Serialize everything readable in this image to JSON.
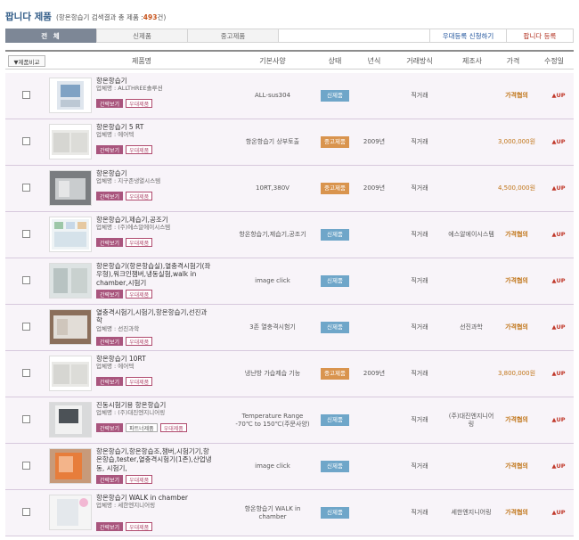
{
  "header": {
    "title": "팝니다 제품",
    "sub": "(항온항습기 검색결과 총 제품 :",
    "count": "493",
    "sub2": "건)"
  },
  "tabs": [
    {
      "label": "전 체",
      "kind": "active"
    },
    {
      "label": "신제품",
      "kind": "normal"
    },
    {
      "label": "중고제품",
      "kind": "normal"
    },
    {
      "label": "",
      "kind": "blank"
    },
    {
      "label": "우대등록 신청하기",
      "kind": "link"
    },
    {
      "label": "팝니다 등록",
      "kind": "link red"
    }
  ],
  "table_header": {
    "compare": "▼제품비교",
    "name": "제품명",
    "spec": "기본사양",
    "status": "상태",
    "year": "년식",
    "trade": "거래방식",
    "maker": "제조사",
    "price": "가격",
    "updated": "수정일"
  },
  "labels": {
    "detail": "간략보기",
    "preferred": "우대제품",
    "partner": "파트너제품",
    "up": "▲UP"
  },
  "colors": {
    "accent": "#2f5a86",
    "new_badge": "#6fa6c9",
    "used_badge": "#d9944e",
    "price": "#c07417"
  },
  "rows": [
    {
      "name": "항온항습기",
      "company": "업체명 : ALLTHREE솔루션",
      "spec": "ALL-sus304",
      "status": "신제품",
      "status_kind": "new",
      "year": "",
      "trade": "직거래",
      "maker": "",
      "price": "가격협의",
      "price_kind": "nego",
      "partner": false,
      "thumb": "blue"
    },
    {
      "name": "항온항습기 5 RT",
      "company": "업체명 : 에어텍",
      "spec": "항온항습기 상부토출",
      "status": "중고제품",
      "status_kind": "used",
      "year": "2009년",
      "trade": "직거래",
      "maker": "",
      "price": "3,000,000원",
      "price_kind": "num",
      "partner": false,
      "thumb": "cabinet"
    },
    {
      "name": "항온항습기",
      "company": "업체명 : 지구존냉열시스템",
      "spec": "10RT,380V",
      "status": "중고제품",
      "status_kind": "used",
      "year": "2009년",
      "trade": "직거래",
      "maker": "",
      "price": "4,500,000원",
      "price_kind": "num",
      "partner": false,
      "thumb": "dark"
    },
    {
      "name": "항온항습기,제습기,공조기",
      "company": "업체명 : (주)에스알에이시스템",
      "spec": "항온항습기,제습기,공조기",
      "status": "신제품",
      "status_kind": "new",
      "year": "",
      "trade": "직거래",
      "maker": "에스알에이시스템",
      "price": "가격협의",
      "price_kind": "nego",
      "partner": false,
      "thumb": "chart"
    },
    {
      "name": "항온항습기(항온항습실),열충격시험기(좌우형),워크인챔버,냉동실험,walk in chamber,시험기",
      "company": "",
      "spec": "image click",
      "status": "신제품",
      "status_kind": "new",
      "year": "",
      "trade": "직거래",
      "maker": "",
      "price": "가격협의",
      "price_kind": "nego",
      "partner": false,
      "thumb": "room"
    },
    {
      "name": "열충격시험기,시험기,항온항습기,선진과학",
      "company": "업체명 : 선진과학",
      "spec": "3존 열충격시험기",
      "status": "신제품",
      "status_kind": "new",
      "year": "",
      "trade": "직거래",
      "maker": "선진과학",
      "price": "가격협의",
      "price_kind": "nego",
      "partner": false,
      "thumb": "room2"
    },
    {
      "name": "항온항습기 10RT",
      "company": "업체명 : 에어텍",
      "spec": "냉난방 가습제습 기능",
      "status": "중고제품",
      "status_kind": "used",
      "year": "2009년",
      "trade": "직거래",
      "maker": "",
      "price": "3,800,000원",
      "price_kind": "num",
      "partner": false,
      "thumb": "cabinet"
    },
    {
      "name": "진동시험기용 항온항습기",
      "company": "업체명 : (주)대진엔지니어링",
      "spec": "Temperature Range -70℃ to 150℃(주문사양)",
      "status": "신제품",
      "status_kind": "new",
      "year": "",
      "trade": "직거래",
      "maker": "(주)대진엔지니어링",
      "price": "가격협의",
      "price_kind": "nego",
      "partner": true,
      "thumb": "machine"
    },
    {
      "name": "항온항습기,항온항습조,챔버,시험기기,항온항습,tester,열충격시험기(1존),산업냉동, 시험기,",
      "company": "",
      "spec": "image click",
      "status": "신제품",
      "status_kind": "new",
      "year": "",
      "trade": "직거래",
      "maker": "",
      "price": "가격협의",
      "price_kind": "nego",
      "partner": false,
      "thumb": "orange"
    },
    {
      "name": "항온항습기 WALK in chamber",
      "company": "업체명 : 세한엔지니어링",
      "spec": "항온항습기 WALK in chamber",
      "status": "신제품",
      "status_kind": "new",
      "year": "",
      "trade": "직거래",
      "maker": "세한엔지니어링",
      "price": "가격협의",
      "price_kind": "nego",
      "partner": false,
      "thumb": "walkin"
    }
  ]
}
